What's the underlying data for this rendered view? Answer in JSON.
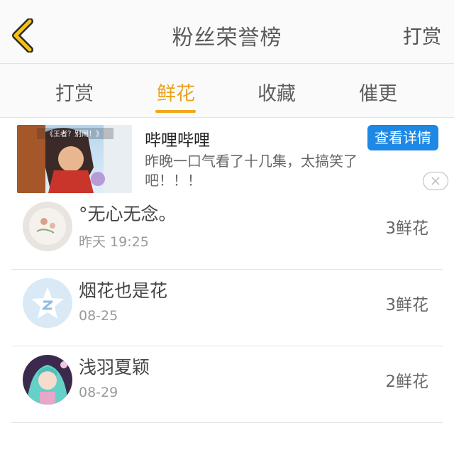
{
  "header": {
    "title": "粉丝荣誉榜",
    "right_link": "打赏",
    "back_icon": "chevron-left-icon",
    "accent_color": "#efa81c"
  },
  "tabs": [
    {
      "label": "打赏",
      "active": false
    },
    {
      "label": "鲜花",
      "active": true
    },
    {
      "label": "收藏",
      "active": false
    },
    {
      "label": "催更",
      "active": false
    }
  ],
  "ad": {
    "title": "哔哩哔哩",
    "button_label": "查看详情",
    "description": "昨晚一口气看了十几集，太搞笑了吧！！！",
    "thumb_caption": "《王者？别闹！》",
    "button_color": "#1e88e5"
  },
  "list": [
    {
      "name": "°无心无念。",
      "date": "昨天 19:25",
      "flowers": "3鲜花",
      "avatar": "floral-plate-avatar"
    },
    {
      "name": "烟花也是花",
      "date": "08-25",
      "flowers": "3鲜花",
      "avatar": "default-star-avatar"
    },
    {
      "name": "浅羽夏颖",
      "date": "08-29",
      "flowers": "2鲜花",
      "avatar": "anime-girl-avatar"
    }
  ]
}
